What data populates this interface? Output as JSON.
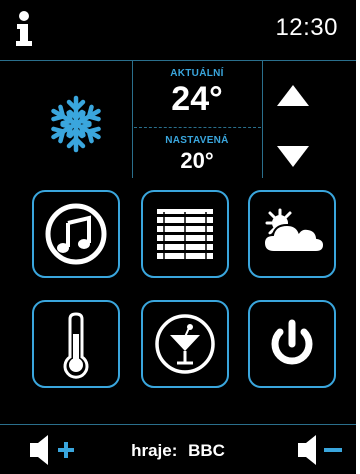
{
  "header": {
    "info_icon": "info-icon",
    "time": "12:30"
  },
  "climate": {
    "mode_icon": "snowflake-icon",
    "current_label": "AKTUÁLNÍ",
    "current_temp": "24°",
    "set_label": "NASTAVENÁ",
    "set_temp": "20°",
    "up_icon": "arrow-up-icon",
    "down_icon": "arrow-down-icon"
  },
  "tiles": [
    {
      "icon": "music-icon"
    },
    {
      "icon": "blinds-icon"
    },
    {
      "icon": "weather-icon"
    },
    {
      "icon": "thermometer-icon"
    },
    {
      "icon": "cocktail-icon"
    },
    {
      "icon": "power-icon"
    }
  ],
  "footer": {
    "playing_label": "hraje:",
    "station": "BBC",
    "volume_up_icon": "volume-up-icon",
    "volume_down_icon": "volume-down-icon"
  },
  "colors": {
    "accent": "#3aa6dd",
    "background": "#000000",
    "text": "#ffffff",
    "divider": "#2a6f8c"
  }
}
